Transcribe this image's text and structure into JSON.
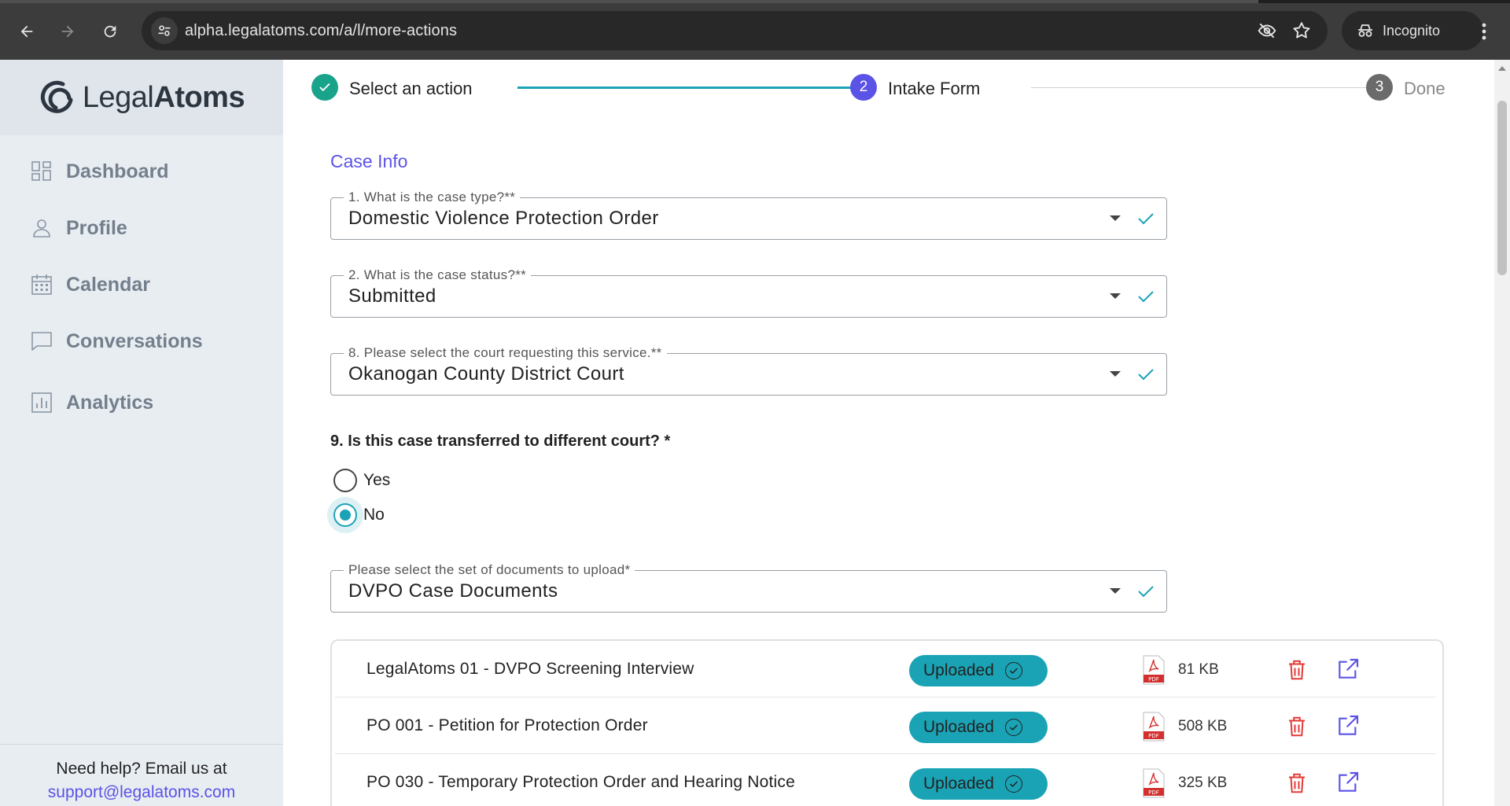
{
  "browser": {
    "url": "alpha.legalatoms.com/a/l/more-actions",
    "profile_label": "Incognito"
  },
  "sidebar": {
    "logo_light": "Legal",
    "logo_bold": "Atoms",
    "items": [
      {
        "label": "Dashboard",
        "icon": "grid-icon"
      },
      {
        "label": "Profile",
        "icon": "user-icon"
      },
      {
        "label": "Calendar",
        "icon": "calendar-icon"
      },
      {
        "label": "Conversations",
        "icon": "chat-icon"
      },
      {
        "label": "Analytics",
        "icon": "chart-icon"
      }
    ],
    "help_text": "Need help? Email us at",
    "help_email": "support@legalatoms.com"
  },
  "stepper": {
    "steps": [
      {
        "number": "✓",
        "label": "Select an action",
        "state": "complete"
      },
      {
        "number": "2",
        "label": "Intake Form",
        "state": "active"
      },
      {
        "number": "3",
        "label": "Done",
        "state": "pending"
      }
    ]
  },
  "form": {
    "section_title": "Case Info",
    "fields": [
      {
        "label": "1. What is the case type?**",
        "value": "Domestic Violence Protection Order"
      },
      {
        "label": "2. What is the case status?**",
        "value": "Submitted"
      },
      {
        "label": "8. Please select the court requesting this service.**",
        "value": "Okanogan County District Court"
      }
    ],
    "question": "9. Is this case transferred to different court? *",
    "options": [
      {
        "label": "Yes",
        "checked": false
      },
      {
        "label": "No",
        "checked": true
      }
    ],
    "doc_set_field": {
      "label": "Please select the set of documents to upload*",
      "value": "DVPO Case Documents"
    }
  },
  "documents": [
    {
      "name": "LegalAtoms 01 - DVPO Screening Interview",
      "status": "Uploaded",
      "size": "81 KB"
    },
    {
      "name": "PO 001 - Petition for Protection Order",
      "status": "Uploaded",
      "size": "508 KB"
    },
    {
      "name": "PO 030 - Temporary Protection Order and Hearing Notice",
      "status": "Uploaded",
      "size": "325 KB"
    }
  ],
  "colors": {
    "accent": "#5b52e6",
    "teal": "#1aa3b5",
    "danger": "#e53935"
  }
}
